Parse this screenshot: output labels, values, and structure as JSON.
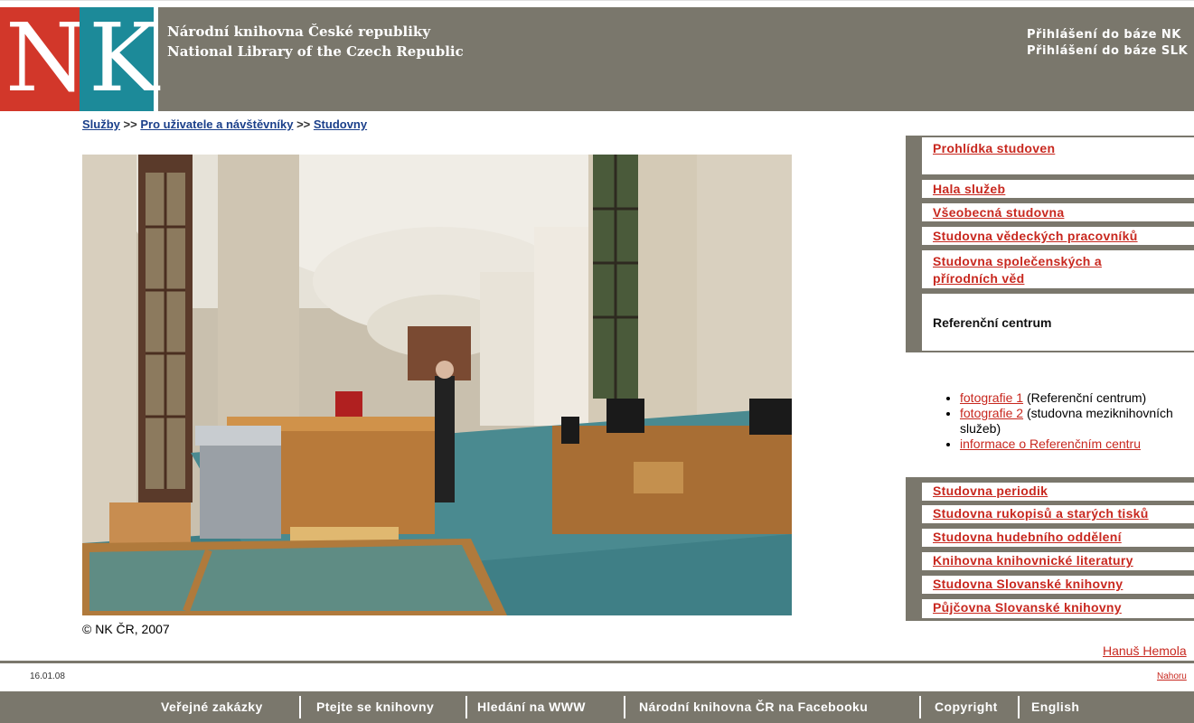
{
  "header": {
    "logo_n": "N",
    "logo_k": "K",
    "name_cs": "Národní knihovna České republiky",
    "name_en": "National Library of the Czech Republic",
    "login1": "Přihlášení do báze NK",
    "login2": "Přihlášení do báze SLK"
  },
  "breadcrumb": {
    "item1": "Služby",
    "sep": ">>",
    "item2": "Pro uživatele a návštěvníky",
    "item3": "Studovny"
  },
  "photo": {
    "caption": "© NK ČR, 2007"
  },
  "menu": {
    "items": [
      "Prohlídka studoven",
      "Hala služeb",
      "Všeobecná studovna",
      "Studovna vědeckých pracovníků",
      "Studovna společenských a přírodních věd",
      "Referenční centrum",
      "Studovna periodik",
      "Studovna rukopisů a starých tisků",
      "Studovna hudebního oddělení",
      "Knihovna knihovnické literatury",
      "Studovna Slovanské knihovny",
      "Půjčovna Slovanské knihovny"
    ],
    "sub": {
      "link1": "fotografie 1",
      "text1": " (Referenční centrum)",
      "link2": "fotografie 2",
      "text2": " (studovna meziknihovních služeb)",
      "link3": "informace o Referenčním centru"
    }
  },
  "author": "Hanuš Hemola",
  "date": "16.01.08",
  "top_link": "Nahoru",
  "footer": [
    "Veřejné zakázky",
    "Ptejte se knihovny",
    "Hledání na WWW",
    "Národní knihovna ČR na Facebooku",
    "Copyright",
    "English"
  ],
  "colors": {
    "header_gray": "#7a776c",
    "logo_red": "#d2372a",
    "logo_teal": "#1c8a99",
    "link_red": "#c8281f"
  }
}
